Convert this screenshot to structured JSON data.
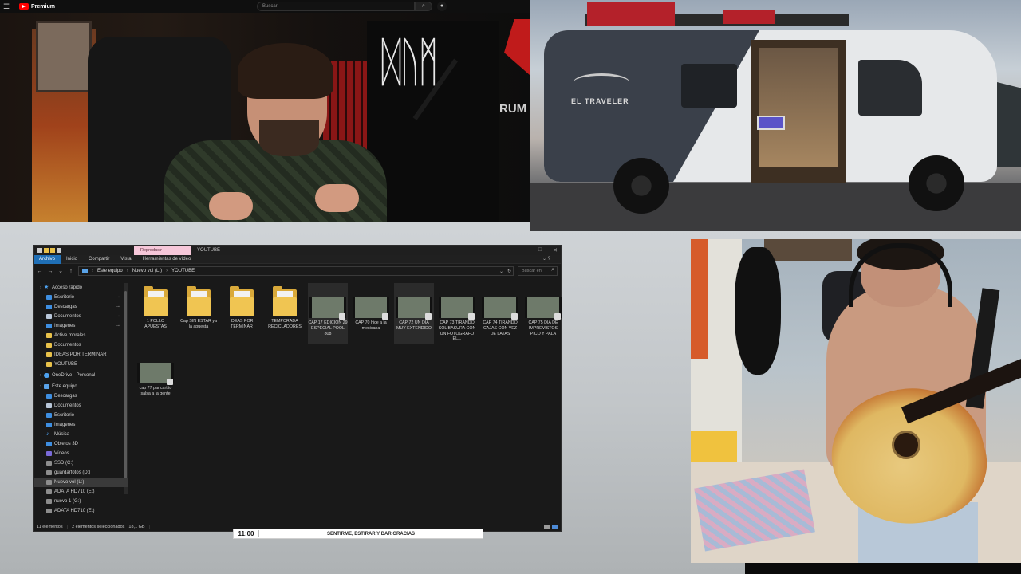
{
  "youtube": {
    "menu_icon": "hamburger-icon",
    "brand": "Premium",
    "search_placeholder": "Buscar",
    "search_icon": "search-icon",
    "mic_icon": "microphone-icon"
  },
  "host_cam": {
    "side_text": "RUM"
  },
  "van_image": {
    "brand_text": "EL TRAVELER"
  },
  "explorer": {
    "context_tab": "Reproducir",
    "window_title": "YOUTUBE",
    "ribbon_tabs": [
      "Archivo",
      "Inicio",
      "Compartir",
      "Vista",
      "Herramientas de vídeo"
    ],
    "address": [
      "Este equipo",
      "Nuevo vol (L:)",
      "YOUTUBE"
    ],
    "search_placeholder": "Buscar en",
    "nav": [
      {
        "label": "Acceso rápido",
        "icon": "star",
        "level": 0
      },
      {
        "label": "Escritorio",
        "icon": "blue",
        "level": 1,
        "pinned": true
      },
      {
        "label": "Descargas",
        "icon": "blue",
        "level": 1,
        "pinned": true
      },
      {
        "label": "Documentos",
        "icon": "doc",
        "level": 1,
        "pinned": true
      },
      {
        "label": "Imágenes",
        "icon": "blue",
        "level": 1,
        "pinned": true
      },
      {
        "label": "Active morales",
        "icon": "folder",
        "level": 1
      },
      {
        "label": "Documentos",
        "icon": "folder",
        "level": 1
      },
      {
        "label": "IDEAS POR TERMINAR",
        "icon": "folder",
        "level": 1
      },
      {
        "label": "YOUTUBE",
        "icon": "folder",
        "level": 1
      },
      {
        "label": "OneDrive - Personal",
        "icon": "cloud",
        "level": 0
      },
      {
        "label": "Este equipo",
        "icon": "pc",
        "level": 0
      },
      {
        "label": "Descargas",
        "icon": "blue",
        "level": 1
      },
      {
        "label": "Documentos",
        "icon": "doc",
        "level": 1
      },
      {
        "label": "Escritorio",
        "icon": "blue",
        "level": 1
      },
      {
        "label": "Imágenes",
        "icon": "blue",
        "level": 1
      },
      {
        "label": "Música",
        "icon": "music",
        "level": 1
      },
      {
        "label": "Objetos 3D",
        "icon": "blue",
        "level": 1
      },
      {
        "label": "Vídeos",
        "icon": "vid",
        "level": 1
      },
      {
        "label": "SSD (C:)",
        "icon": "drive",
        "level": 1
      },
      {
        "label": "guardarfotos (D:)",
        "icon": "drive",
        "level": 1
      },
      {
        "label": "Nuevo vol (L:)",
        "icon": "drive",
        "level": 1,
        "selected": true
      },
      {
        "label": "ADATA HD710 (E:)",
        "icon": "drive",
        "level": 1
      },
      {
        "label": "nuevo 1 (G:)",
        "icon": "drive",
        "level": 1
      },
      {
        "label": "ADATA HD710 (E:)",
        "icon": "drive",
        "level": 1
      }
    ],
    "items": [
      {
        "label": "1 POLLO APUESTAS",
        "type": "folder"
      },
      {
        "label": "Cap SIN ESTAR ya la apuesta",
        "type": "folder"
      },
      {
        "label": "IDEAS POR TERMINAR",
        "type": "folder"
      },
      {
        "label": "TEMPORADA RECICLADORES",
        "type": "folder"
      },
      {
        "label": "CAP 17 EDICION 29 ESPECIAL POOL 808",
        "type": "video",
        "highlight": true
      },
      {
        "label": "CAP 70 hice a la mexicana",
        "type": "video"
      },
      {
        "label": "CAP 72 UN DÍA MUY EXTENDIDO",
        "type": "video",
        "highlight": true
      },
      {
        "label": "CAP 73 TIRANDO SOL BASURA CON UN FOTOGRAFO EL...",
        "type": "video"
      },
      {
        "label": "CAP 74 TIRANDO CAJAS CON VEZ DE LATAS",
        "type": "video"
      },
      {
        "label": "CAP 75 DÍA DE IMPREVISTOS PICO Y PALA",
        "type": "video"
      },
      {
        "label": "cap 77 pancartito salsa a la gente",
        "type": "video"
      }
    ],
    "status": {
      "count": "11 elementos",
      "selected": "2 elementos seleccionados",
      "size": "18,1 GB"
    }
  },
  "topic_bar": {
    "time": "11:00",
    "text": "SENTIRME, ESTIRAR Y DAR GRACIAS"
  },
  "colors": {
    "explorer_bg": "#191919",
    "ribbon_active": "#1f6fb6",
    "context_tab": "#f6c7d9",
    "folder": "#e8c14a"
  }
}
